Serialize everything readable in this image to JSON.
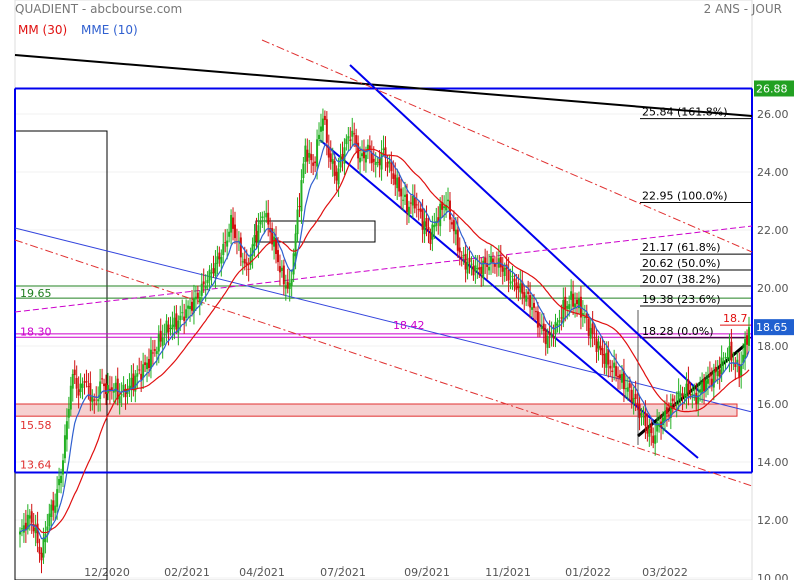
{
  "header": {
    "source": "QUADIENT - abcbourse.com",
    "period": "2 ANS - JOUR"
  },
  "legend": {
    "ma": "MM (30)",
    "ema": "MME (10)"
  },
  "colors": {
    "ma": "#e01010",
    "ema": "#3060d0",
    "up": "#22b022",
    "down": "#d01010",
    "channel": "#0000ee",
    "fib": "#000000",
    "magenta": "#cc00cc",
    "support": "#e03030"
  },
  "chart_data": {
    "type": "candlestick",
    "ylim": [
      10,
      28
    ],
    "yticks": [
      "10.00",
      "12.00",
      "14.00",
      "16.00",
      "18.00",
      "20.00",
      "22.00",
      "24.00",
      "26.00"
    ],
    "xticks": [
      "12/2020",
      "02/2021",
      "04/2021",
      "07/2021",
      "09/2021",
      "11/2021",
      "01/2022",
      "03/2022"
    ],
    "last_price": "18.65",
    "high_level": "26.88",
    "recent_high": "18.7",
    "fibonacci": [
      {
        "value": 25.84,
        "label": "25.84  (161.8%)"
      },
      {
        "value": 22.95,
        "label": "22.95  (100.0%)"
      },
      {
        "value": 21.17,
        "label": "21.17  (61.8%)"
      },
      {
        "value": 20.62,
        "label": "20.62  (50.0%)"
      },
      {
        "value": 20.07,
        "label": "20.07  (38.2%)"
      },
      {
        "value": 19.38,
        "label": "19.38  (23.6%)"
      },
      {
        "value": 18.28,
        "label": "18.28  (0.0%)"
      }
    ],
    "levels": [
      {
        "value": 19.65,
        "label": "19.65"
      },
      {
        "value": 18.3,
        "label": "18.30"
      },
      {
        "value": 15.58,
        "label": "15.58"
      },
      {
        "value": 13.64,
        "label": "13.64"
      }
    ],
    "mid_label": "18.42",
    "anchors": [
      [
        0,
        11.5
      ],
      [
        3,
        11.9
      ],
      [
        5,
        12.1
      ],
      [
        7,
        11.8
      ],
      [
        9,
        11.2
      ],
      [
        11,
        10.7
      ],
      [
        13,
        11.6
      ],
      [
        15,
        12.2
      ],
      [
        18,
        12.6
      ],
      [
        20,
        13.3
      ],
      [
        22,
        14.1
      ],
      [
        24,
        15.4
      ],
      [
        26,
        16.6
      ],
      [
        28,
        17.1
      ],
      [
        30,
        16.2
      ],
      [
        32,
        16.9
      ],
      [
        35,
        16.5
      ],
      [
        38,
        16.0
      ],
      [
        42,
        16.8
      ],
      [
        45,
        16.4
      ],
      [
        48,
        16.6
      ],
      [
        50,
        16.3
      ],
      [
        53,
        16.4
      ],
      [
        56,
        16.6
      ],
      [
        60,
        17.0
      ],
      [
        63,
        17.2
      ],
      [
        66,
        17.5
      ],
      [
        70,
        18.0
      ],
      [
        75,
        18.6
      ],
      [
        80,
        18.8
      ],
      [
        85,
        19.2
      ],
      [
        90,
        19.6
      ],
      [
        95,
        20.2
      ],
      [
        100,
        20.8
      ],
      [
        105,
        21.5
      ],
      [
        108,
        22.3
      ],
      [
        112,
        21.4
      ],
      [
        116,
        20.6
      ],
      [
        120,
        21.7
      ],
      [
        125,
        22.6
      ],
      [
        130,
        21.5
      ],
      [
        134,
        20.4
      ],
      [
        138,
        19.9
      ],
      [
        142,
        22.5
      ],
      [
        146,
        24.8
      ],
      [
        150,
        24.2
      ],
      [
        152,
        24.9
      ],
      [
        155,
        26.0
      ],
      [
        158,
        24.6
      ],
      [
        162,
        23.8
      ],
      [
        166,
        24.9
      ],
      [
        170,
        25.4
      ],
      [
        174,
        24.4
      ],
      [
        178,
        24.8
      ],
      [
        182,
        24.2
      ],
      [
        186,
        24.7
      ],
      [
        190,
        24.0
      ],
      [
        194,
        23.4
      ],
      [
        198,
        22.8
      ],
      [
        202,
        23.0
      ],
      [
        206,
        22.3
      ],
      [
        210,
        21.8
      ],
      [
        214,
        22.5
      ],
      [
        218,
        23.0
      ],
      [
        222,
        22.0
      ],
      [
        226,
        21.0
      ],
      [
        230,
        20.8
      ],
      [
        234,
        20.6
      ],
      [
        238,
        20.8
      ],
      [
        242,
        20.9
      ],
      [
        246,
        20.8
      ],
      [
        250,
        20.4
      ],
      [
        254,
        20.1
      ],
      [
        258,
        19.8
      ],
      [
        262,
        19.4
      ],
      [
        266,
        18.7
      ],
      [
        270,
        18.2
      ],
      [
        274,
        18.6
      ],
      [
        278,
        19.3
      ],
      [
        282,
        19.6
      ],
      [
        286,
        19.4
      ],
      [
        290,
        18.8
      ],
      [
        294,
        18.2
      ],
      [
        298,
        17.7
      ],
      [
        302,
        17.3
      ],
      [
        306,
        17.0
      ],
      [
        310,
        16.6
      ],
      [
        314,
        16.2
      ],
      [
        318,
        15.6
      ],
      [
        322,
        15.0
      ],
      [
        324,
        14.8
      ],
      [
        326,
        15.2
      ],
      [
        330,
        15.6
      ],
      [
        334,
        16.0
      ],
      [
        338,
        16.3
      ],
      [
        342,
        16.5
      ],
      [
        346,
        16.2
      ],
      [
        350,
        16.7
      ],
      [
        354,
        16.9
      ],
      [
        358,
        17.2
      ],
      [
        362,
        17.8
      ],
      [
        365,
        17.5
      ],
      [
        368,
        17.1
      ],
      [
        370,
        17.7
      ],
      [
        372,
        18.3
      ],
      [
        373,
        18.65
      ]
    ]
  }
}
